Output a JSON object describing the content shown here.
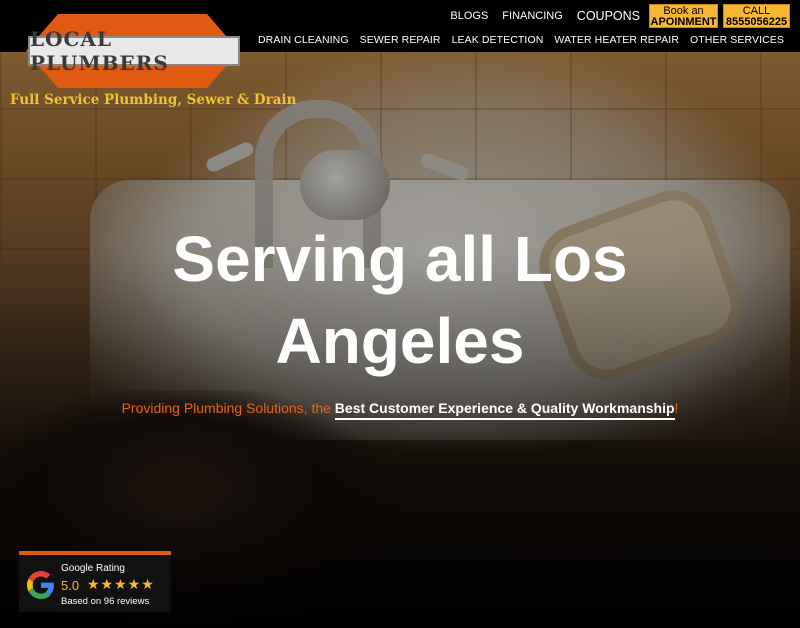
{
  "brand": {
    "logo_text": "LOCAL PLUMBERS",
    "tagline": "Full Service Plumbing, Sewer & Drain",
    "accent_color": "#e05a12",
    "cta_color": "#f7b733"
  },
  "top_links": [
    "BLOGS",
    "FINANCING",
    "COUPONS"
  ],
  "cta": {
    "book_line1": "Book an",
    "book_line2": "APOINMENT",
    "call_line1": "CALL",
    "call_line2": "8555056225"
  },
  "nav": [
    "DRAIN CLEANING",
    "SEWER REPAIR",
    "LEAK DETECTION",
    "WATER HEATER REPAIR",
    "OTHER SERVICES"
  ],
  "hero": {
    "headline_line1": "Serving all Los",
    "headline_line2": "Angeles",
    "sub_prefix": "Providing Plumbing Solutions, the ",
    "sub_highlight": "Best Customer Experience & Quality Workmanship",
    "sub_suffix": "!"
  },
  "rating": {
    "title": "Google Rating",
    "score": "5.0",
    "stars": 5,
    "stars_text": "★★★★★",
    "count_text": "Based on 96 reviews",
    "icon": "google-g-icon"
  }
}
